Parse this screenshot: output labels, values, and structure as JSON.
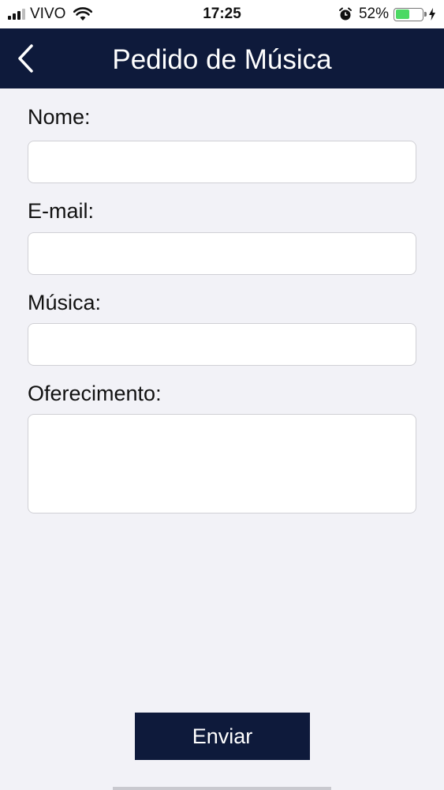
{
  "status_bar": {
    "carrier": "VIVO",
    "time": "17:25",
    "battery": "52%",
    "battery_level": 0.52,
    "icons": [
      "signal-icon",
      "wifi-icon",
      "alarm-icon",
      "battery-icon",
      "charging-icon"
    ]
  },
  "nav": {
    "title": "Pedido de Música",
    "back_icon": "chevron-left-icon"
  },
  "form": {
    "name_label": "Nome:",
    "name_value": "",
    "email_label": "E-mail:",
    "email_value": "",
    "music_label": "Música:",
    "music_value": "",
    "dedication_label": "Oferecimento:",
    "dedication_value": ""
  },
  "actions": {
    "send_label": "Enviar"
  },
  "colors": {
    "navy": "#0e1a3b",
    "background": "#f2f2f7",
    "battery_green": "#4cd964"
  }
}
